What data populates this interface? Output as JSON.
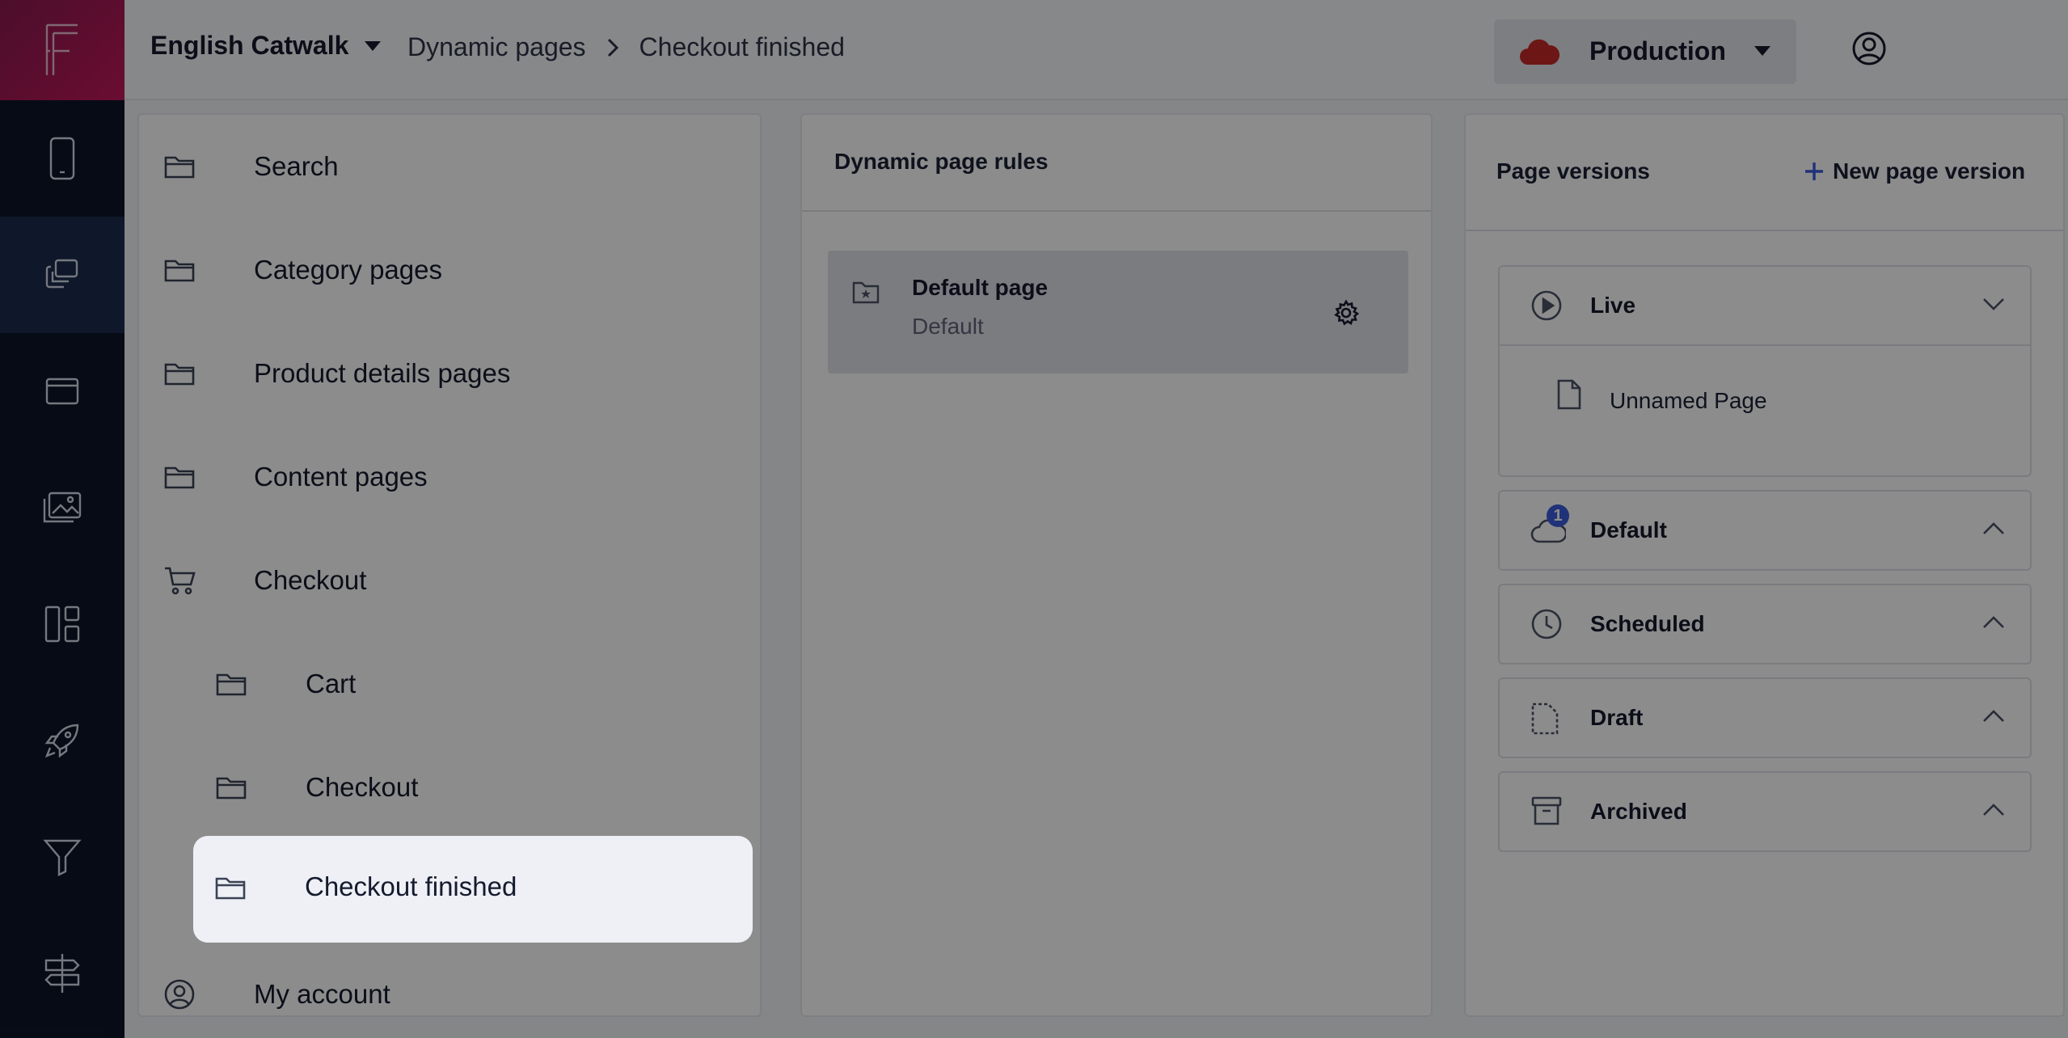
{
  "app": {
    "store_name": "English Catwalk",
    "environment": "Production",
    "accent_color": "#c2185b"
  },
  "breadcrumb": {
    "items": [
      "Dynamic pages",
      "Checkout finished"
    ]
  },
  "rail": {
    "icons": [
      "mobile-icon",
      "pages-icon",
      "window-icon",
      "images-icon",
      "layout-icon",
      "rocket-icon",
      "filter-icon",
      "signpost-icon"
    ]
  },
  "tree": {
    "items": [
      {
        "label": "Search",
        "icon": "folder-icon"
      },
      {
        "label": "Category pages",
        "icon": "folder-icon"
      },
      {
        "label": "Product details pages",
        "icon": "folder-icon"
      },
      {
        "label": "Content pages",
        "icon": "folder-icon"
      },
      {
        "label": "Checkout",
        "icon": "cart-icon"
      },
      {
        "label": "Cart",
        "icon": "folder-icon"
      },
      {
        "label": "Checkout",
        "icon": "folder-icon"
      },
      {
        "label": "Checkout finished",
        "icon": "folder-icon"
      },
      {
        "label": "My account",
        "icon": "user-icon"
      }
    ]
  },
  "rules": {
    "title": "Dynamic page rules",
    "card": {
      "title": "Default page",
      "subtitle": "Default"
    }
  },
  "versions": {
    "title": "Page versions",
    "new_label": "New page version",
    "groups": [
      {
        "label": "Live",
        "child": "Unnamed Page"
      },
      {
        "label": "Default",
        "badge": "1"
      },
      {
        "label": "Scheduled"
      },
      {
        "label": "Draft"
      },
      {
        "label": "Archived"
      }
    ]
  }
}
